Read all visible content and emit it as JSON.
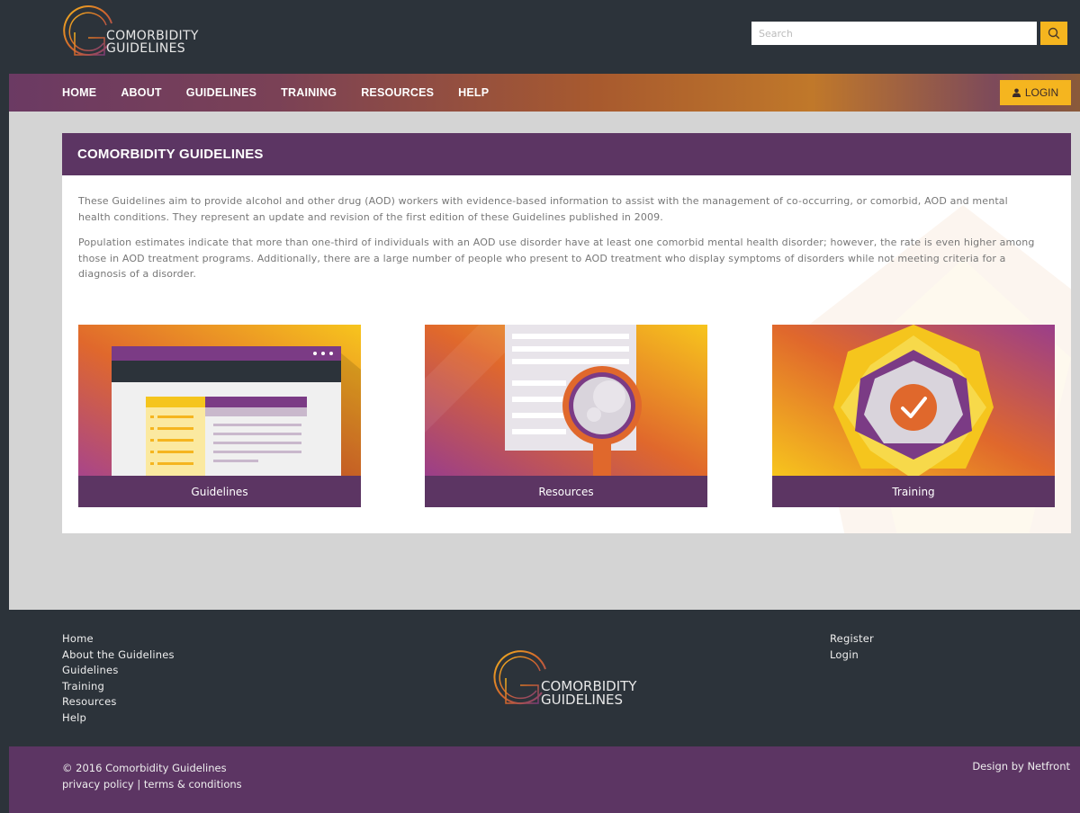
{
  "colors": {
    "dark": "#2c333a",
    "purple": "#5c3563",
    "accent": "#f5b51f",
    "orange": "#e07a2a"
  },
  "header": {
    "logo_line1": "COMORBIDITY",
    "logo_line2": "GUIDELINES",
    "search_placeholder": "Search",
    "search_icon": "search-icon"
  },
  "nav": {
    "items": [
      "HOME",
      "ABOUT",
      "GUIDELINES",
      "TRAINING",
      "RESOURCES",
      "HELP"
    ],
    "login_label": "LOGIN",
    "login_icon": "user-icon"
  },
  "main": {
    "title": "COMORBIDITY GUIDELINES",
    "paragraph1": "These Guidelines aim to provide alcohol and other drug (AOD) workers with evidence-based information to assist with the management of co-occurring, or comorbid, AOD and mental health conditions. They represent an update and revision of the first edition of these Guidelines published in 2009.",
    "paragraph2": "Population estimates indicate that more than one-third of individuals with an AOD use disorder have at least one comorbid mental health disorder; however, the rate is even higher among those in AOD treatment programs. Additionally, there are a large number of people who present to AOD treatment who display symptoms of disorders while not meeting criteria for a diagnosis of a disorder.",
    "cards": [
      {
        "label": "Guidelines",
        "icon": "browser-window-icon"
      },
      {
        "label": "Resources",
        "icon": "magnifier-document-icon"
      },
      {
        "label": "Training",
        "icon": "checkmark-badge-icon"
      }
    ]
  },
  "footer": {
    "links_left": [
      "Home",
      "About the Guidelines",
      "Guidelines",
      "Training",
      "Resources",
      "Help"
    ],
    "links_right": [
      "Register",
      "Login"
    ],
    "logo_line1": "COMORBIDITY",
    "logo_line2": "GUIDELINES",
    "copyright": "© 2016 Comorbidity Guidelines",
    "privacy": "privacy policy",
    "separator": " | ",
    "terms": "terms & conditions",
    "design_credit": "Design by Netfront"
  }
}
